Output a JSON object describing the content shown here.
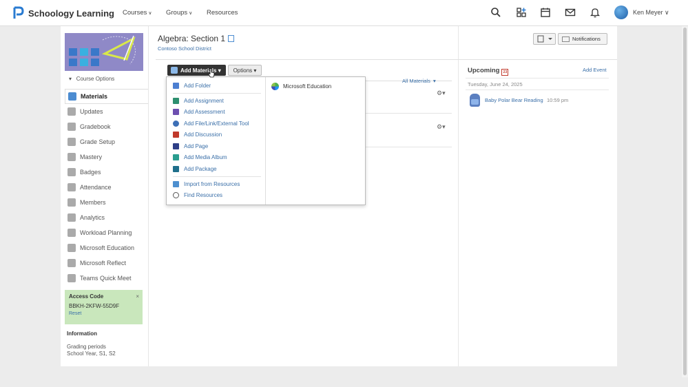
{
  "nav": {
    "brand": "Schoology Learning",
    "items": [
      {
        "label": "Courses",
        "caret": "∨"
      },
      {
        "label": "Groups",
        "caret": "∨"
      },
      {
        "label": "Resources",
        "caret": ""
      }
    ],
    "icons": [
      "search-icon",
      "apps-icon",
      "calendar-icon",
      "messages-icon",
      "bell-icon"
    ],
    "user_name": "Ken Meyer",
    "user_caret": "∨"
  },
  "sidebar": {
    "course_options": "Course Options",
    "items": [
      {
        "label": "Materials",
        "active": true
      },
      {
        "label": "Updates"
      },
      {
        "label": "Gradebook"
      },
      {
        "label": "Grade Setup"
      },
      {
        "label": "Mastery"
      },
      {
        "label": "Badges"
      },
      {
        "label": "Attendance"
      },
      {
        "label": "Members"
      },
      {
        "label": "Analytics"
      },
      {
        "label": "Workload Planning"
      },
      {
        "label": "Microsoft Education"
      },
      {
        "label": "Microsoft Reflect"
      },
      {
        "label": "Teams Quick Meet"
      }
    ],
    "access": {
      "title": "Access Code",
      "code": "BBKH-2KFW-55D9F",
      "reset": "Reset",
      "close": "×"
    },
    "info": {
      "title": "Information",
      "grading_label": "Grading periods",
      "grading_value": "School Year, S1, S2"
    }
  },
  "main": {
    "title": "Algebra: Section 1",
    "school": "Contoso School District",
    "add_materials": "Add Materials",
    "options": "Options",
    "filter": "All Materials",
    "dropdown": {
      "left": [
        {
          "label": "Add Folder",
          "color": "#4c7fd1"
        },
        {
          "label": "Add Assignment",
          "color": "#2d8f6f"
        },
        {
          "label": "Add Assessment",
          "color": "#6d4fb0"
        },
        {
          "label": "Add File/Link/External Tool",
          "color": "#3d6fb6"
        },
        {
          "label": "Add Discussion",
          "color": "#c0392b"
        },
        {
          "label": "Add Page",
          "color": "#2e3f87"
        },
        {
          "label": "Add Media Album",
          "color": "#2a9d8f"
        },
        {
          "label": "Add Package",
          "color": "#1f6f8b"
        },
        {
          "label": "Import from Resources",
          "color": "#4d8fcf"
        },
        {
          "label": "Find Resources",
          "color": "#555555"
        }
      ],
      "right": [
        {
          "label": "Microsoft Education"
        }
      ]
    }
  },
  "right": {
    "notifications": "Notifications",
    "upcoming_title": "Upcoming",
    "calendar_day": "23",
    "add_event": "Add Event",
    "date": "Tuesday, June 24, 2025",
    "event": {
      "name": "Baby Polar Bear Reading",
      "time": "10:59 pm"
    }
  },
  "colors": {
    "accent": "#3a6fa8",
    "access_bg": "#c9e7bc",
    "dark_button": "#333333"
  }
}
